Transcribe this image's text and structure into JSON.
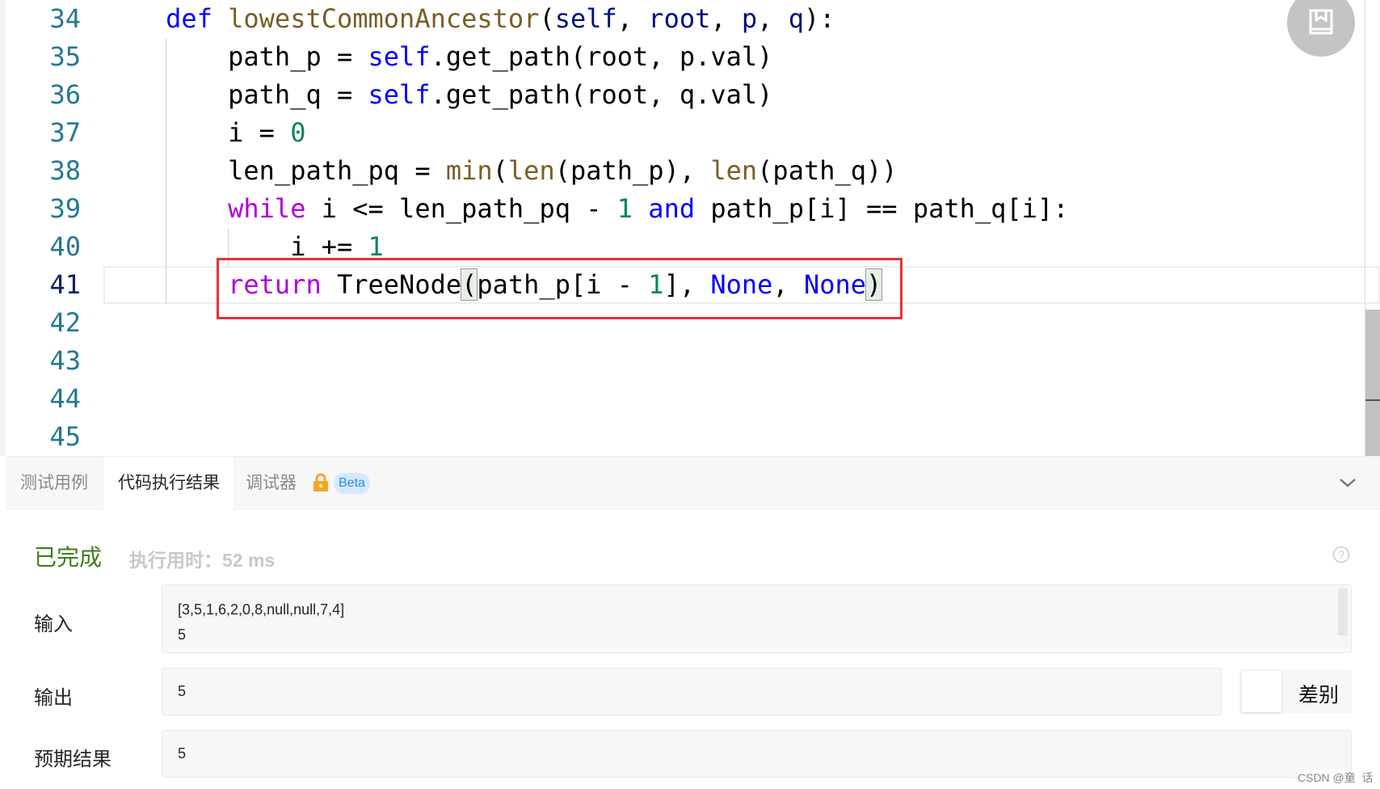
{
  "editor": {
    "line_numbers": [
      "34",
      "35",
      "36",
      "37",
      "38",
      "39",
      "40",
      "41",
      "42",
      "43",
      "44",
      "45"
    ],
    "current_line": "41"
  },
  "colors": {
    "keyword": "#0000ff",
    "function": "#795e26",
    "control": "#af00db",
    "number": "#098658",
    "highlight_box": "#e8303a",
    "status_success": "#3c7d1a"
  },
  "bottom_panel": {
    "tabs": [
      {
        "label": "测试用例"
      },
      {
        "label": "代码执行结果"
      },
      {
        "label": "调试器"
      }
    ],
    "active_tab": "代码执行结果",
    "beta_badge": "Beta",
    "status": "已完成",
    "exec_time": "执行用时：52 ms",
    "input_label": "输入",
    "input_lines": [
      "[3,5,1,6,2,0,8,null,null,7,4]",
      "5"
    ],
    "output_label": "输出",
    "output_value": "5",
    "diff_label": "差别",
    "expected_label": "预期结果",
    "expected_value": "5"
  },
  "watermark": "CSDN @童  话"
}
